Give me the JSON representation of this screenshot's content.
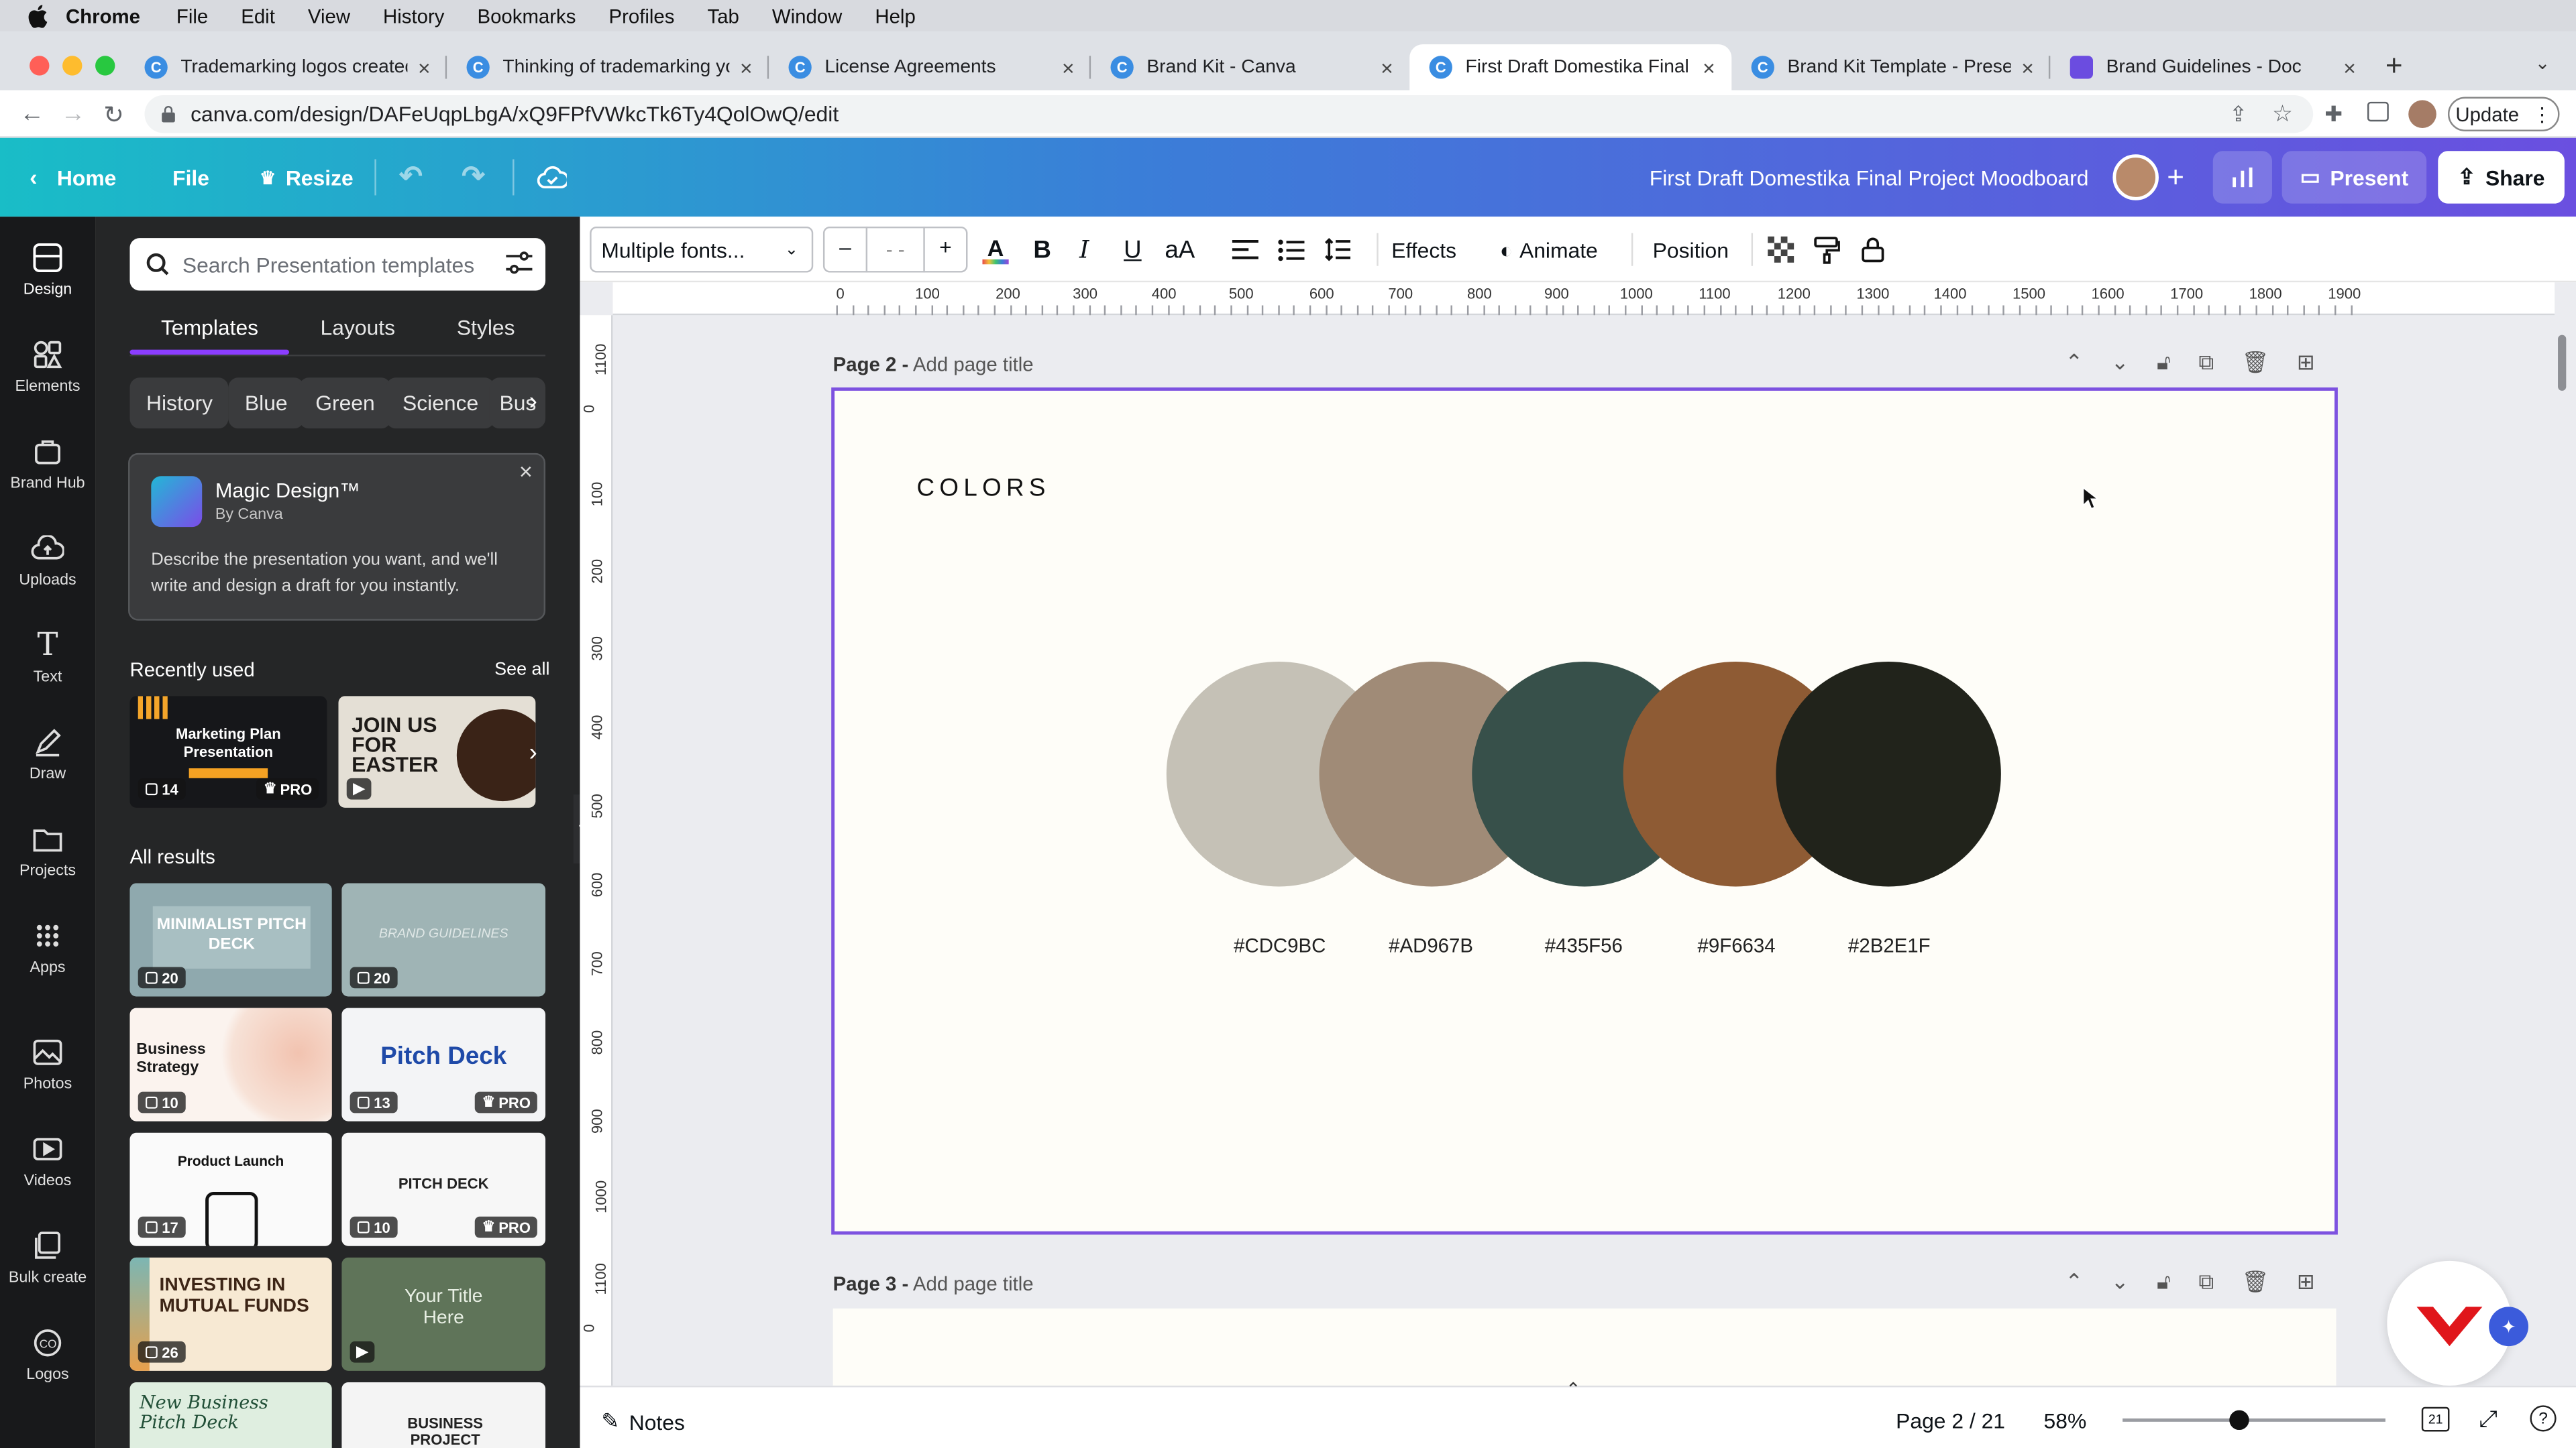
{
  "menubar": {
    "app": "Chrome",
    "items": [
      "File",
      "Edit",
      "View",
      "History",
      "Bookmarks",
      "Profiles",
      "Tab",
      "Window",
      "Help"
    ]
  },
  "tabs": [
    {
      "title": "Trademarking logos created or",
      "icon": "canva-favicon"
    },
    {
      "title": "Thinking of trademarking your",
      "icon": "canva-favicon"
    },
    {
      "title": "License Agreements",
      "icon": "canva-favicon"
    },
    {
      "title": "Brand Kit - Canva",
      "icon": "canva-favicon"
    },
    {
      "title": "First Draft Domestika Final Pro",
      "icon": "canva-favicon"
    },
    {
      "title": "Brand Kit Template - Presentat",
      "icon": "canva-favicon"
    },
    {
      "title": "Brand Guidelines - Doc",
      "icon": "doc-favicon"
    }
  ],
  "browser": {
    "url": "canva.com/design/DAFeUqpLbgA/xQ9FPfVWkcTk6Ty4QolOwQ/edit",
    "update_label": "Update"
  },
  "header": {
    "home": "Home",
    "file": "File",
    "resize": "Resize",
    "doc_title": "First Draft Domestika Final Project Moodboard",
    "present": "Present",
    "share": "Share"
  },
  "rail": [
    {
      "label": "Design",
      "icon": "design-icon"
    },
    {
      "label": "Elements",
      "icon": "elements-icon"
    },
    {
      "label": "Brand Hub",
      "icon": "brand-hub-icon"
    },
    {
      "label": "Uploads",
      "icon": "uploads-icon"
    },
    {
      "label": "Text",
      "icon": "text-icon"
    },
    {
      "label": "Draw",
      "icon": "draw-icon"
    },
    {
      "label": "Projects",
      "icon": "projects-icon"
    },
    {
      "label": "Apps",
      "icon": "apps-icon"
    },
    {
      "label": "Photos",
      "icon": "photos-icon"
    },
    {
      "label": "Videos",
      "icon": "videos-icon"
    },
    {
      "label": "Bulk create",
      "icon": "bulk-create-icon"
    },
    {
      "label": "Logos",
      "icon": "logos-icon"
    }
  ],
  "panel": {
    "search_placeholder": "Search Presentation templates",
    "tabs": [
      "Templates",
      "Layouts",
      "Styles"
    ],
    "chips": [
      "History",
      "Blue",
      "Green",
      "Science",
      "Bus"
    ],
    "magic": {
      "title": "Magic Design™",
      "by": "By Canva",
      "desc": "Describe the presentation you want, and we'll write and design a draft for you instantly."
    },
    "recent_title": "Recently used",
    "see_all": "See all",
    "recent": [
      {
        "title": "Marketing Plan Presentation",
        "count": "14",
        "pro": "PRO"
      },
      {
        "title": "JOIN US FOR EASTER",
        "count": "",
        "pro": ""
      }
    ],
    "all_title": "All results",
    "results": [
      {
        "title": "MINIMALIST PITCH DECK",
        "count": "20",
        "pro": ""
      },
      {
        "title": "BRAND GUIDELINES",
        "count": "20",
        "pro": ""
      },
      {
        "title": "Business Strategy",
        "count": "10",
        "pro": ""
      },
      {
        "title": "Pitch Deck",
        "count": "13",
        "pro": "PRO"
      },
      {
        "title": "Product Launch",
        "count": "17",
        "pro": ""
      },
      {
        "title": "PITCH DECK",
        "count": "10",
        "pro": "PRO"
      },
      {
        "title": "INVESTING IN MUTUAL FUNDS",
        "count": "26",
        "pro": ""
      },
      {
        "title": "Your Title Here",
        "count": "",
        "pro": ""
      },
      {
        "title": "New Business Pitch Deck",
        "count": "",
        "pro": ""
      },
      {
        "title": "BUSINESS PROJECT",
        "count": "",
        "pro": ""
      }
    ]
  },
  "toolbar": {
    "font": "Multiple fonts...",
    "size": "- -",
    "effects": "Effects",
    "animate": "Animate",
    "position": "Position"
  },
  "ruler_top": [
    "0",
    "100",
    "200",
    "300",
    "400",
    "500",
    "600",
    "700",
    "800",
    "900",
    "1000",
    "1100",
    "1200",
    "1300",
    "1400",
    "1500",
    "1600",
    "1700",
    "1800",
    "1900"
  ],
  "ruler_left": [
    "1100",
    "0",
    "100",
    "200",
    "300",
    "400",
    "500",
    "600",
    "700",
    "800",
    "900",
    "1000",
    "1100",
    "0"
  ],
  "page2": {
    "label": "Page 2 -",
    "placeholder": "Add page title",
    "heading": "COLORS"
  },
  "colors": [
    {
      "hex": "#CDC9BC",
      "color": "#c5c1b6"
    },
    {
      "hex": "#AD967B",
      "color": "#a08b77"
    },
    {
      "hex": "#435F56",
      "color": "#37504a"
    },
    {
      "hex": "#9F6634",
      "color": "#8e5b34"
    },
    {
      "hex": "#2B2E1F",
      "color": "#21231b"
    }
  ],
  "page3": {
    "label": "Page 3 -",
    "placeholder": "Add page title"
  },
  "bottom": {
    "notes": "Notes",
    "page_counter": "Page 2 / 21",
    "zoom": "58%",
    "pages_count": "21",
    "zoom_level": 0.58
  }
}
